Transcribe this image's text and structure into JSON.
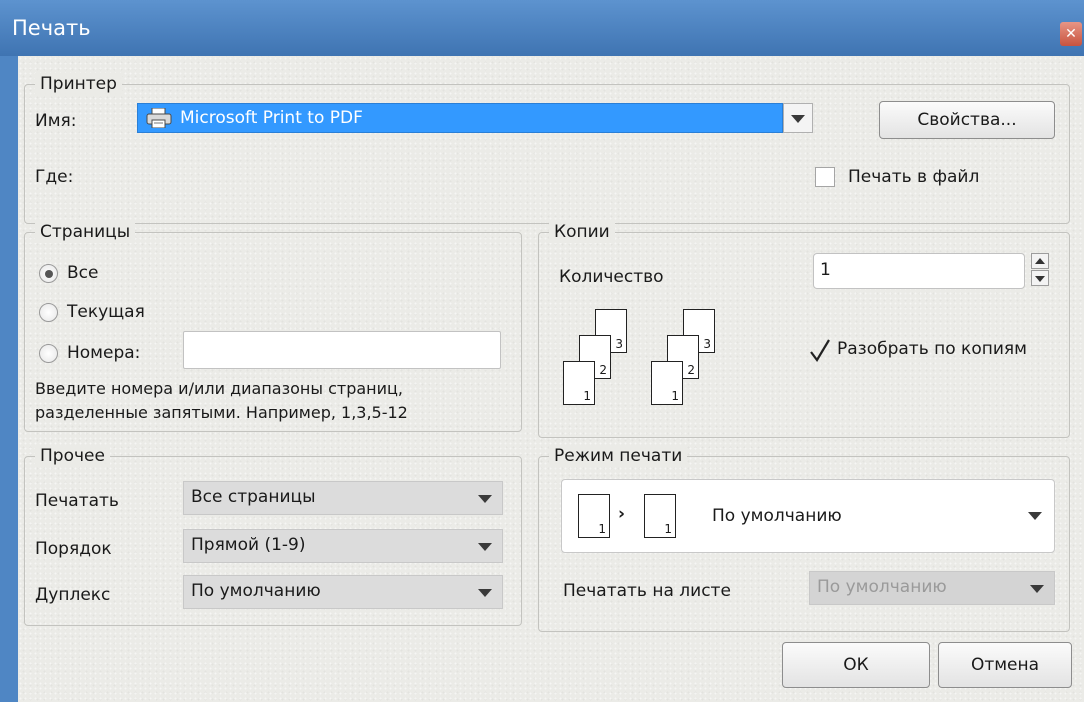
{
  "dialog": {
    "title": "Печать"
  },
  "printer": {
    "legend": "Принтер",
    "name_label": "Имя:",
    "name_value": "Microsoft Print to PDF",
    "where_label": "Где:",
    "properties_button": "Свойства...",
    "print_to_file_label": "Печать в файл",
    "print_to_file_checked": false
  },
  "pages": {
    "legend": "Страницы",
    "options": [
      "Все",
      "Текущая",
      "Номера:"
    ],
    "selected": "Все",
    "page_numbers_value": "",
    "hint_line1": "Введите номера и/или диапазоны страниц,",
    "hint_line2": "разделенные запятыми. Например, 1,3,5-12"
  },
  "copies": {
    "legend": "Копии",
    "count_label": "Количество",
    "count_value": "1",
    "collate_label": "Разобрать по копиям",
    "collate_checked": true,
    "page_numbers": [
      "1",
      "2",
      "3"
    ]
  },
  "other": {
    "legend": "Прочее",
    "print_label": "Печатать",
    "print_value": "Все страницы",
    "order_label": "Порядок",
    "order_value": "Прямой (1-9)",
    "duplex_label": "Дуплекс",
    "duplex_value": "По умолчанию"
  },
  "print_mode": {
    "legend": "Режим печати",
    "mode_value": "По умолчанию",
    "mode_pages": [
      "1",
      "1"
    ],
    "per_sheet_label": "Печатать на листе",
    "per_sheet_value": "По умолчанию"
  },
  "buttons": {
    "ok": "ОК",
    "cancel": "Отмена"
  },
  "colors": {
    "title_bar": "#4f86c4",
    "selection": "#3399ff",
    "dialog_bg": "#ebebe7"
  }
}
